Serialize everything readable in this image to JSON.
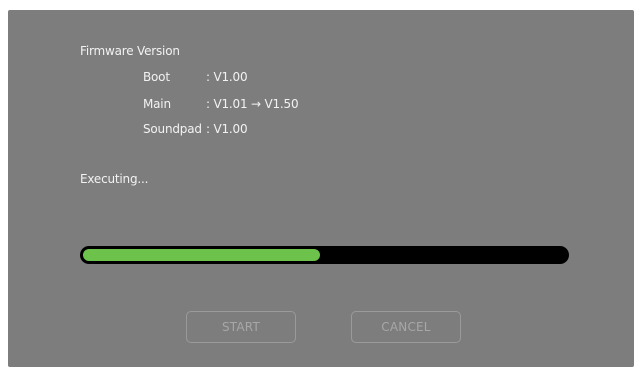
{
  "firmware": {
    "title": "Firmware Version",
    "rows": [
      {
        "label": "Boot",
        "value": ": V1.00"
      },
      {
        "label": "Main",
        "value": ": V1.01 → V1.50"
      },
      {
        "label": "Soundpad",
        "value": ": V1.00"
      }
    ]
  },
  "status": {
    "text": "Executing..."
  },
  "progress": {
    "fraction": 0.49,
    "fill_color": "#6cc24a",
    "track_color": "#000000"
  },
  "buttons": {
    "start_label": "START",
    "cancel_label": "CANCEL"
  },
  "colors": {
    "dialog_background": "#7d7d7d",
    "text": "#f2f2f2",
    "disabled_button": "#a7a7a7"
  }
}
